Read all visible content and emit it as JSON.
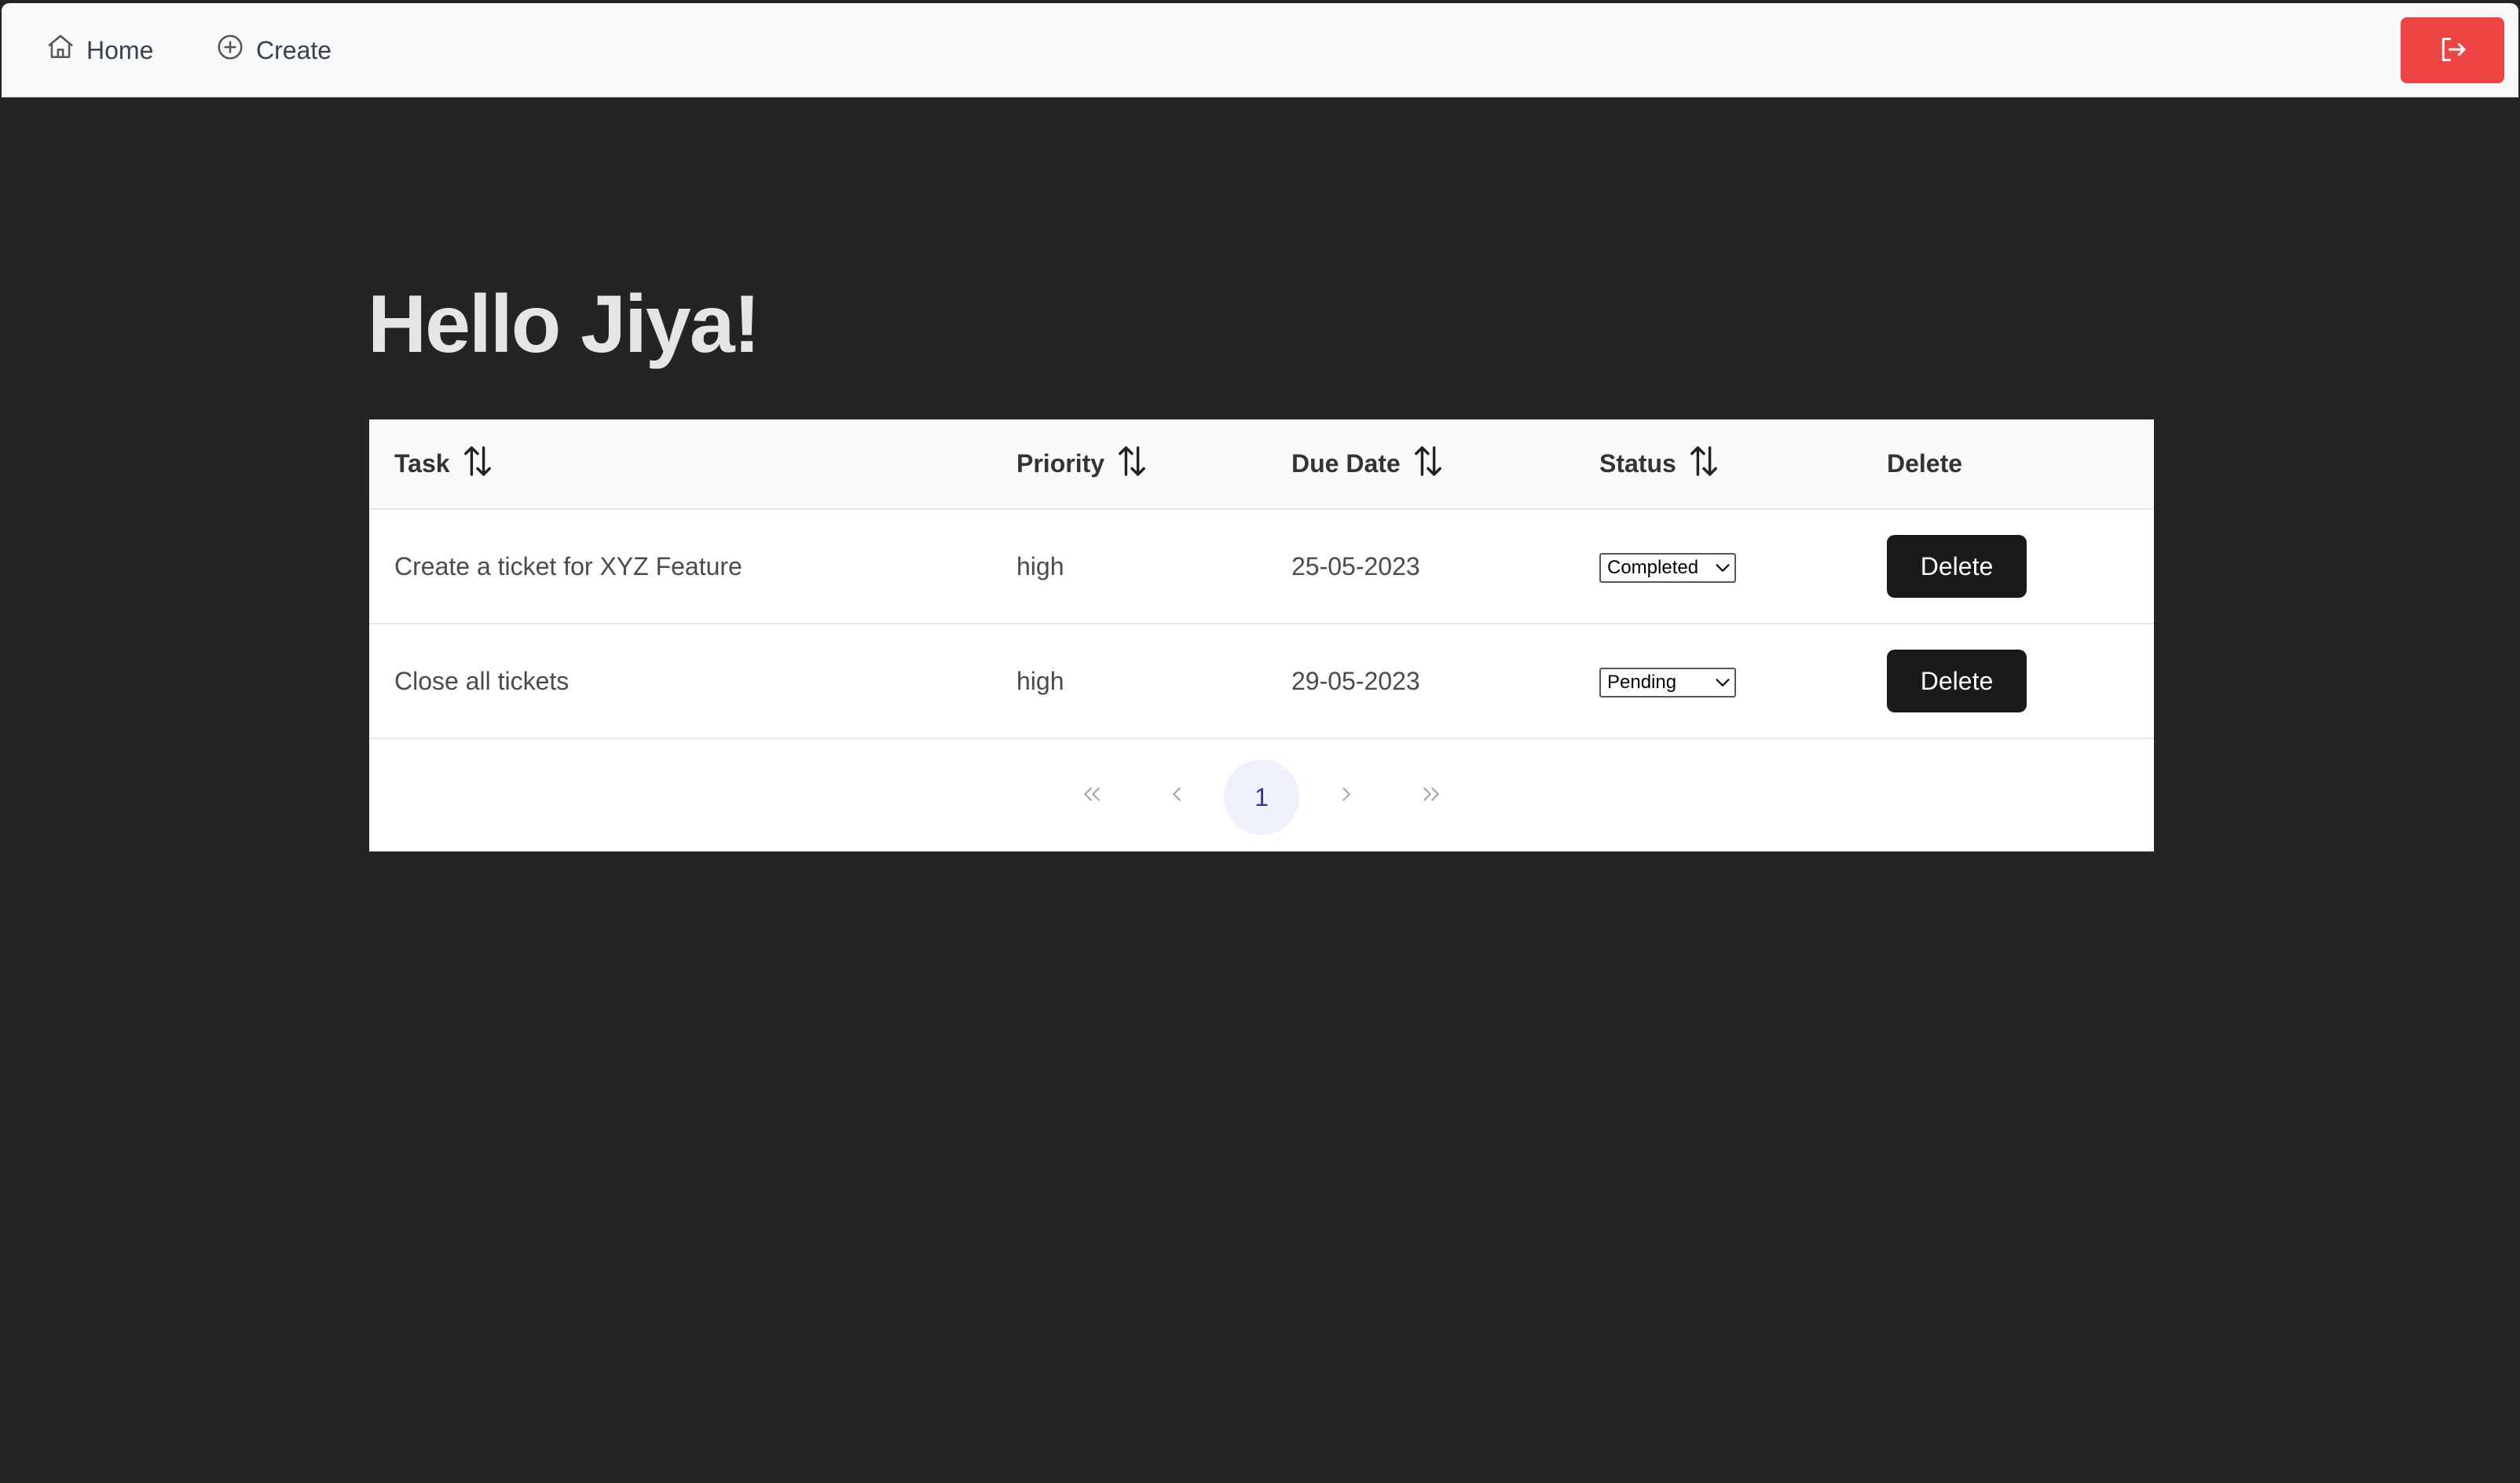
{
  "nav": {
    "home_label": "Home",
    "create_label": "Create",
    "logout_icon": "logout-icon",
    "logout_color": "#ef4444"
  },
  "greeting": "Hello Jiya!",
  "table": {
    "headers": {
      "task": "Task",
      "priority": "Priority",
      "due_date": "Due Date",
      "status": "Status",
      "delete": "Delete"
    },
    "rows": [
      {
        "task": "Create a ticket for XYZ Feature",
        "priority": "high",
        "due_date": "25-05-2023",
        "status": "Completed",
        "delete_label": "Delete"
      },
      {
        "task": "Close all tickets",
        "priority": "high",
        "due_date": "29-05-2023",
        "status": "Pending",
        "delete_label": "Delete"
      }
    ]
  },
  "pagination": {
    "current_page": "1"
  }
}
